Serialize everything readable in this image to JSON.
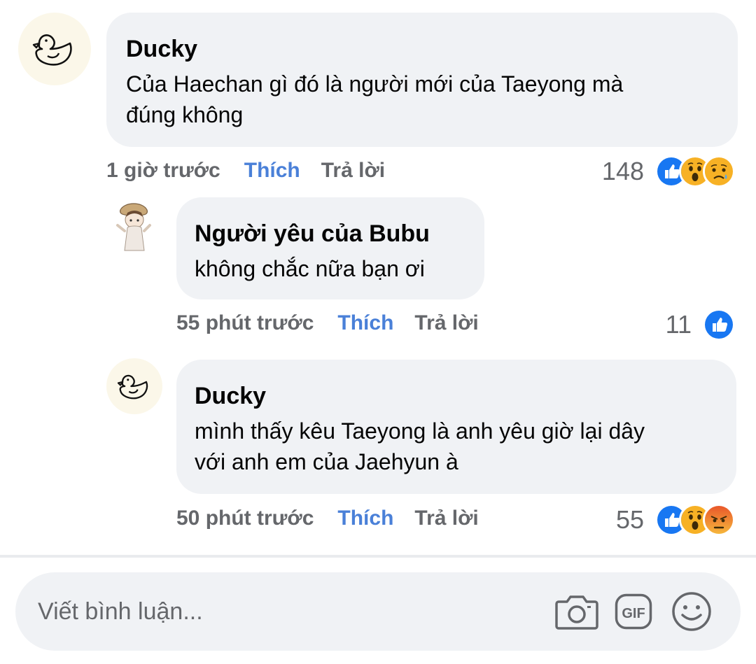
{
  "comments": [
    {
      "author": "Ducky",
      "lines": [
        "Của Haechan gì đó là người mới của Taeyong mà",
        "đúng không"
      ],
      "time": "1 giờ trước",
      "like_label": "Thích",
      "reply_label": "Trả lời",
      "reaction_count": "148",
      "reactions": [
        "like-icon",
        "wow-icon",
        "sad-icon"
      ],
      "avatar": "duck-avatar-icon"
    },
    {
      "author": "Người yêu của Bubu",
      "lines": [
        "không chắc nữa bạn ơi"
      ],
      "time": "55 phút trước",
      "like_label": "Thích",
      "reply_label": "Trả lời",
      "reaction_count": "11",
      "reactions": [
        "like-icon"
      ],
      "avatar": "anime-character-avatar"
    },
    {
      "author": "Ducky",
      "lines": [
        "mình thấy kêu Taeyong là anh yêu giờ lại dây",
        "với anh em của Jaehyun à"
      ],
      "time": "50 phút trước",
      "like_label": "Thích",
      "reply_label": "Trả lời",
      "reaction_count": "55",
      "reactions": [
        "like-icon",
        "wow-icon",
        "angry-icon"
      ],
      "avatar": "duck-avatar-icon"
    }
  ],
  "composer": {
    "placeholder": "Viết bình luận...",
    "icons": [
      "camera-icon",
      "gif-icon",
      "emoji-icon"
    ]
  },
  "colors": {
    "bubble": "#f0f2f5",
    "like_text": "#4a80d8",
    "meta_text": "#65676b",
    "like_reaction": "#1877f2"
  }
}
